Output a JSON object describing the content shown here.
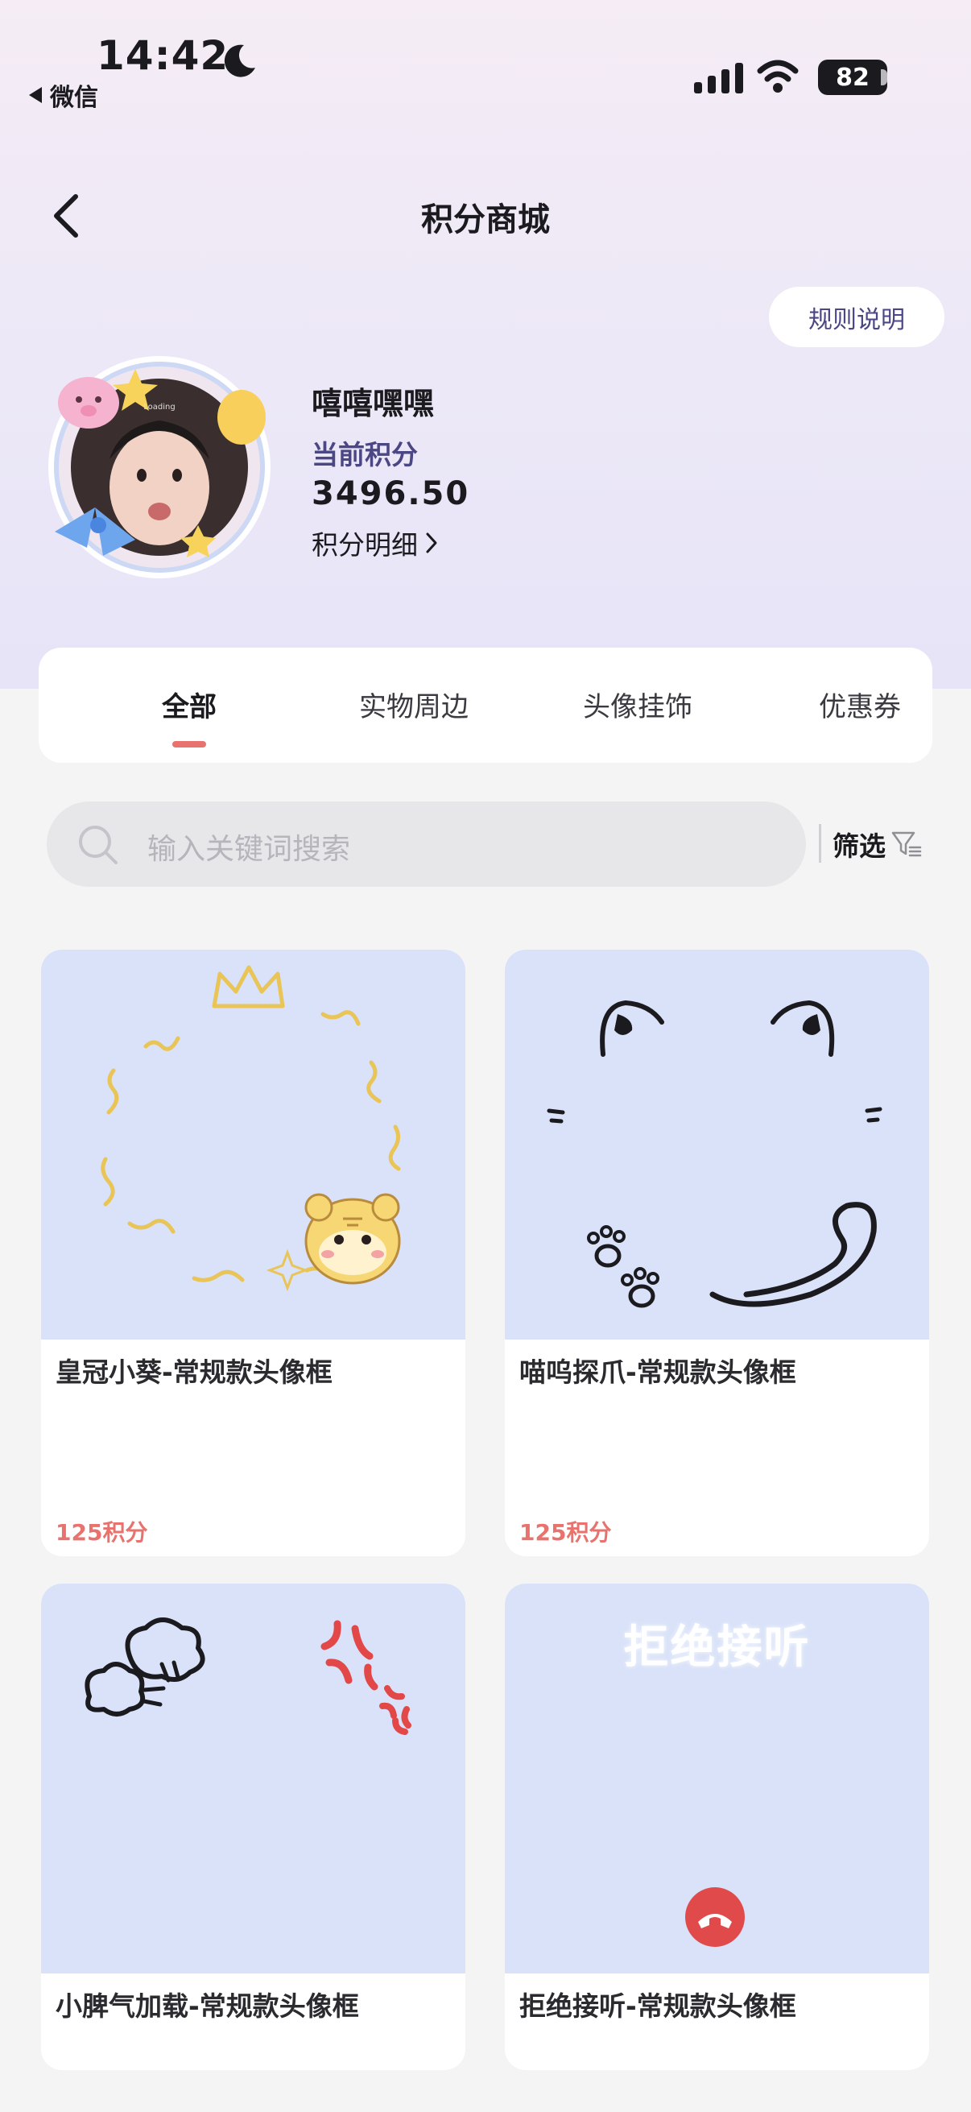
{
  "status_bar": {
    "time": "14:42",
    "back_app": "微信",
    "battery": "82"
  },
  "header": {
    "title": "积分商城",
    "rules_button": "规则说明"
  },
  "profile": {
    "name": "嘻嘻嘿嘿",
    "points_label": "当前积分",
    "points_value": "3496.50",
    "points_detail": "积分明细"
  },
  "tabs": [
    {
      "label": "全部",
      "active": true
    },
    {
      "label": "实物周边",
      "active": false
    },
    {
      "label": "头像挂饰",
      "active": false
    },
    {
      "label": "优惠券",
      "active": false
    }
  ],
  "search": {
    "placeholder": "输入关键词搜索",
    "filter_label": "筛选"
  },
  "products": [
    {
      "title": "皇冠小葵-常规款头像框",
      "price": "125积分"
    },
    {
      "title": "喵呜探爪-常规款头像框",
      "price": "125积分"
    },
    {
      "title": "小脾气加载-常规款头像框",
      "price": ""
    },
    {
      "title": "拒绝接听-常规款头像框",
      "price": "",
      "image_text": "拒绝接听"
    }
  ],
  "colors": {
    "accent": "#e8736e",
    "brand_text": "#4a4784",
    "card_image_bg": "#d9e2f8"
  }
}
